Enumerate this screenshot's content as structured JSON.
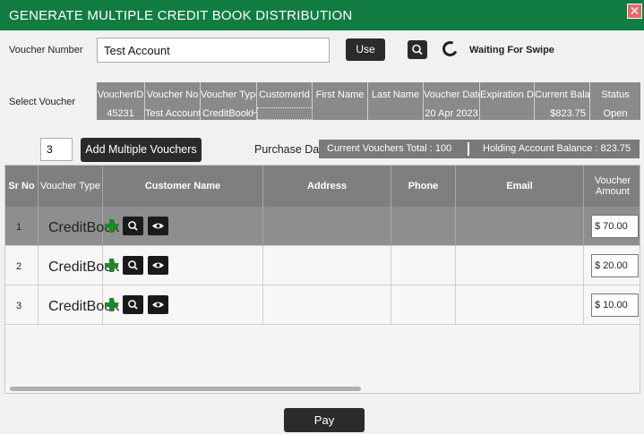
{
  "window": {
    "title": "GENERATE MULTIPLE CREDIT BOOK DISTRIBUTION",
    "close_icon": "close-icon"
  },
  "voucher_number": {
    "label": "Voucher Number",
    "value": "Test Account",
    "use_label": "Use",
    "search_icon": "search-icon",
    "swipe_status": "Waiting For Swipe"
  },
  "select_voucher": {
    "label": "Select Voucher",
    "headers": [
      "VoucherID",
      "Voucher No",
      "Voucher Type",
      "CustomerId",
      "First Name",
      "Last Name",
      "Voucher Date",
      "Expiration Date",
      "Current Balance",
      "Status"
    ],
    "row": [
      "45231",
      "Test Account",
      "CreditBookHolder",
      "",
      "",
      "",
      "20 Apr 2023",
      "",
      "$823.75",
      "Open"
    ]
  },
  "add_section": {
    "quantity": "3",
    "add_label": "Add Multiple Vouchers",
    "purchase_label": "Purchase Date",
    "vouchers_total": "Current Vouchers Total : 100",
    "holding_balance": "Holding Account Balance : 823.75"
  },
  "grid": {
    "headers": {
      "sr_no": "Sr No",
      "voucher_type": "Voucher Type",
      "customer_name": "Customer Name",
      "address": "Address",
      "phone": "Phone",
      "email": "Email",
      "voucher_amount": "Voucher Amount"
    },
    "rows": [
      {
        "sr": "1",
        "type": "CreditBook",
        "amount": "$ 70.00",
        "selected": true
      },
      {
        "sr": "2",
        "type": "CreditBook",
        "amount": "$ 20.00",
        "selected": false
      },
      {
        "sr": "3",
        "type": "CreditBook",
        "amount": "$ 10.00",
        "selected": false
      }
    ],
    "icons": [
      "plus-icon",
      "search-icon",
      "eye-icon"
    ]
  },
  "footer": {
    "pay_label": "Pay"
  }
}
